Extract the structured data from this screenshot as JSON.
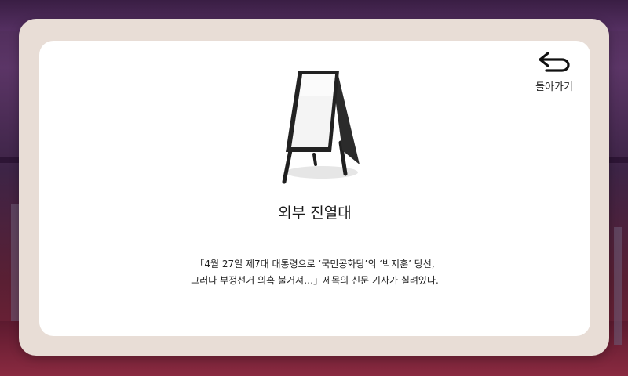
{
  "back_button": {
    "label": "돌아가기",
    "icon": "back-arrow-icon"
  },
  "item": {
    "icon": "a-frame-sign-icon",
    "title": "외부 진열대",
    "description_lines": [
      "「4월 27일 제7대 대통령으로 ‘국민공화당’의 ‘박지훈’ 당선,",
      "그러나 부정선거 의혹 불거져…」제목의 신문 기사가 실려있다."
    ]
  }
}
